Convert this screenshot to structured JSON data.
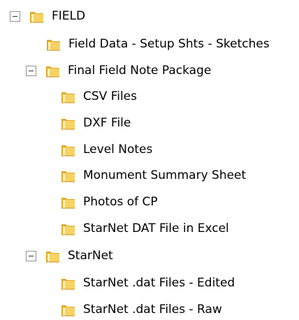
{
  "tree": {
    "nodes": [
      {
        "label": "FIELD",
        "level": 0,
        "expanded": true,
        "icon": "folder-icon"
      },
      {
        "label": "Field Data - Setup Shts - Sketches",
        "level": 1,
        "expanded": null,
        "icon": "folder-icon"
      },
      {
        "label": "Final Field Note Package",
        "level": 1,
        "expanded": true,
        "icon": "folder-icon"
      },
      {
        "label": "CSV Files",
        "level": 2,
        "expanded": null,
        "icon": "folder-icon"
      },
      {
        "label": "DXF File",
        "level": 2,
        "expanded": null,
        "icon": "folder-icon"
      },
      {
        "label": "Level Notes",
        "level": 2,
        "expanded": null,
        "icon": "folder-icon"
      },
      {
        "label": "Monument Summary Sheet",
        "level": 2,
        "expanded": null,
        "icon": "folder-icon"
      },
      {
        "label": "Photos of CP",
        "level": 2,
        "expanded": null,
        "icon": "folder-icon"
      },
      {
        "label": "StarNet DAT File in Excel",
        "level": 2,
        "expanded": null,
        "icon": "folder-icon"
      },
      {
        "label": "StarNet",
        "level": 1,
        "expanded": true,
        "icon": "folder-icon"
      },
      {
        "label": "StarNet .dat Files - Edited",
        "level": 2,
        "expanded": null,
        "icon": "folder-icon"
      },
      {
        "label": "StarNet .dat Files - Raw",
        "level": 2,
        "expanded": null,
        "icon": "folder-icon"
      }
    ]
  },
  "colors": {
    "folder_body": "#f6d365",
    "folder_shade": "#e0a92b",
    "folder_light": "#fff2b8",
    "toggle_border": "#919191"
  }
}
